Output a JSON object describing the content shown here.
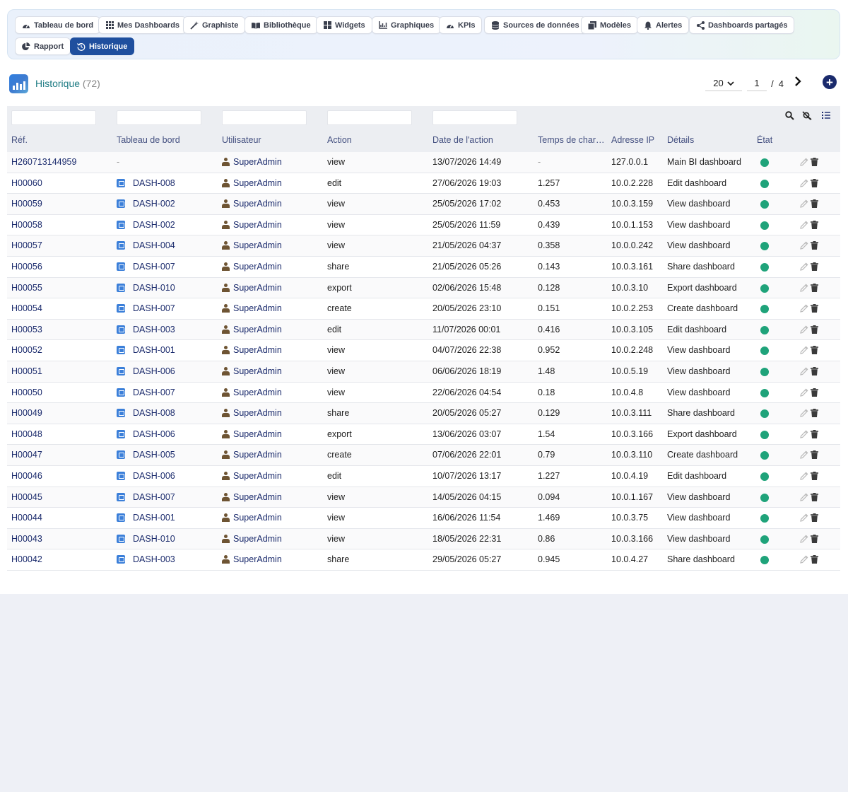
{
  "nav": {
    "items": [
      {
        "label": "Tableau de bord",
        "icon": "gauge-icon",
        "name": "nav-tableau-de-bord"
      },
      {
        "label": "Mes Dashboards",
        "icon": "grid-icon",
        "name": "nav-mes-dashboards"
      },
      {
        "label": "Graphiste",
        "icon": "magic-wand-icon",
        "name": "nav-graphiste"
      },
      {
        "label": "Bibliothèque",
        "icon": "book-icon",
        "name": "nav-bibliotheque"
      },
      {
        "label": "Widgets",
        "icon": "widgets-icon",
        "name": "nav-widgets"
      },
      {
        "label": "Graphiques",
        "icon": "chart-line-icon",
        "name": "nav-graphiques"
      },
      {
        "label": "KPIs",
        "icon": "gauge-icon",
        "name": "nav-kpis"
      },
      {
        "label": "Sources de données",
        "icon": "database-icon",
        "name": "nav-sources"
      },
      {
        "label": "Modèles",
        "icon": "copy-icon",
        "name": "nav-modeles"
      },
      {
        "label": "Alertes",
        "icon": "bell-icon",
        "name": "nav-alertes"
      },
      {
        "label": "Dashboards partagés",
        "icon": "share-icon",
        "name": "nav-partages"
      },
      {
        "label": "Rapport",
        "icon": "pie-chart-icon",
        "name": "nav-rapport"
      },
      {
        "label": "Historique",
        "icon": "history-icon",
        "name": "nav-historique",
        "active": true
      }
    ]
  },
  "header": {
    "title": "Historique",
    "count": "(72)"
  },
  "pager": {
    "page_size": "20",
    "current_page": "1",
    "separator": "/",
    "total_pages": "4"
  },
  "table": {
    "columns": [
      "Réf.",
      "Tableau de bord",
      "Utilisateur",
      "Action",
      "Date de l'action",
      "Temps de char…",
      "Adresse IP",
      "Détails",
      "État"
    ],
    "rows": [
      {
        "ref": "H260713144959",
        "dashboard": "-",
        "user": "SuperAdmin",
        "action": "view",
        "date": "13/07/2026 14:49",
        "time": "-",
        "ip": "127.0.0.1",
        "details": "Main BI dashboard"
      },
      {
        "ref": "H00060",
        "dashboard": "DASH-008",
        "user": "SuperAdmin",
        "action": "edit",
        "date": "27/06/2026 19:03",
        "time": "1.257",
        "ip": "10.0.2.228",
        "details": "Edit dashboard"
      },
      {
        "ref": "H00059",
        "dashboard": "DASH-002",
        "user": "SuperAdmin",
        "action": "view",
        "date": "25/05/2026 17:02",
        "time": "0.453",
        "ip": "10.0.3.159",
        "details": "View dashboard"
      },
      {
        "ref": "H00058",
        "dashboard": "DASH-002",
        "user": "SuperAdmin",
        "action": "view",
        "date": "25/05/2026 11:59",
        "time": "0.439",
        "ip": "10.0.1.153",
        "details": "View dashboard"
      },
      {
        "ref": "H00057",
        "dashboard": "DASH-004",
        "user": "SuperAdmin",
        "action": "view",
        "date": "21/05/2026 04:37",
        "time": "0.358",
        "ip": "10.0.0.242",
        "details": "View dashboard"
      },
      {
        "ref": "H00056",
        "dashboard": "DASH-007",
        "user": "SuperAdmin",
        "action": "share",
        "date": "21/05/2026 05:26",
        "time": "0.143",
        "ip": "10.0.3.161",
        "details": "Share dashboard"
      },
      {
        "ref": "H00055",
        "dashboard": "DASH-010",
        "user": "SuperAdmin",
        "action": "export",
        "date": "02/06/2026 15:48",
        "time": "0.128",
        "ip": "10.0.3.10",
        "details": "Export dashboard"
      },
      {
        "ref": "H00054",
        "dashboard": "DASH-007",
        "user": "SuperAdmin",
        "action": "create",
        "date": "20/05/2026 23:10",
        "time": "0.151",
        "ip": "10.0.2.253",
        "details": "Create dashboard"
      },
      {
        "ref": "H00053",
        "dashboard": "DASH-003",
        "user": "SuperAdmin",
        "action": "edit",
        "date": "11/07/2026 00:01",
        "time": "0.416",
        "ip": "10.0.3.105",
        "details": "Edit dashboard"
      },
      {
        "ref": "H00052",
        "dashboard": "DASH-001",
        "user": "SuperAdmin",
        "action": "view",
        "date": "04/07/2026 22:38",
        "time": "0.952",
        "ip": "10.0.2.248",
        "details": "View dashboard"
      },
      {
        "ref": "H00051",
        "dashboard": "DASH-006",
        "user": "SuperAdmin",
        "action": "view",
        "date": "06/06/2026 18:19",
        "time": "1.48",
        "ip": "10.0.5.19",
        "details": "View dashboard"
      },
      {
        "ref": "H00050",
        "dashboard": "DASH-007",
        "user": "SuperAdmin",
        "action": "view",
        "date": "22/06/2026 04:54",
        "time": "0.18",
        "ip": "10.0.4.8",
        "details": "View dashboard"
      },
      {
        "ref": "H00049",
        "dashboard": "DASH-008",
        "user": "SuperAdmin",
        "action": "share",
        "date": "20/05/2026 05:27",
        "time": "0.129",
        "ip": "10.0.3.111",
        "details": "Share dashboard"
      },
      {
        "ref": "H00048",
        "dashboard": "DASH-006",
        "user": "SuperAdmin",
        "action": "export",
        "date": "13/06/2026 03:07",
        "time": "1.54",
        "ip": "10.0.3.166",
        "details": "Export dashboard"
      },
      {
        "ref": "H00047",
        "dashboard": "DASH-005",
        "user": "SuperAdmin",
        "action": "create",
        "date": "07/06/2026 22:01",
        "time": "0.79",
        "ip": "10.0.3.110",
        "details": "Create dashboard"
      },
      {
        "ref": "H00046",
        "dashboard": "DASH-006",
        "user": "SuperAdmin",
        "action": "edit",
        "date": "10/07/2026 13:17",
        "time": "1.227",
        "ip": "10.0.4.19",
        "details": "Edit dashboard"
      },
      {
        "ref": "H00045",
        "dashboard": "DASH-007",
        "user": "SuperAdmin",
        "action": "view",
        "date": "14/05/2026 04:15",
        "time": "0.094",
        "ip": "10.0.1.167",
        "details": "View dashboard"
      },
      {
        "ref": "H00044",
        "dashboard": "DASH-001",
        "user": "SuperAdmin",
        "action": "view",
        "date": "16/06/2026 11:54",
        "time": "1.469",
        "ip": "10.0.3.75",
        "details": "View dashboard"
      },
      {
        "ref": "H00043",
        "dashboard": "DASH-010",
        "user": "SuperAdmin",
        "action": "view",
        "date": "18/05/2026 22:31",
        "time": "0.86",
        "ip": "10.0.3.166",
        "details": "View dashboard"
      },
      {
        "ref": "H00042",
        "dashboard": "DASH-003",
        "user": "SuperAdmin",
        "action": "share",
        "date": "29/05/2026 05:27",
        "time": "0.945",
        "ip": "10.0.4.27",
        "details": "Share dashboard"
      }
    ]
  },
  "colors": {
    "status_ok": "#1fa37a",
    "primary": "#1a2a6c",
    "active_tab": "#1f4f9e"
  }
}
